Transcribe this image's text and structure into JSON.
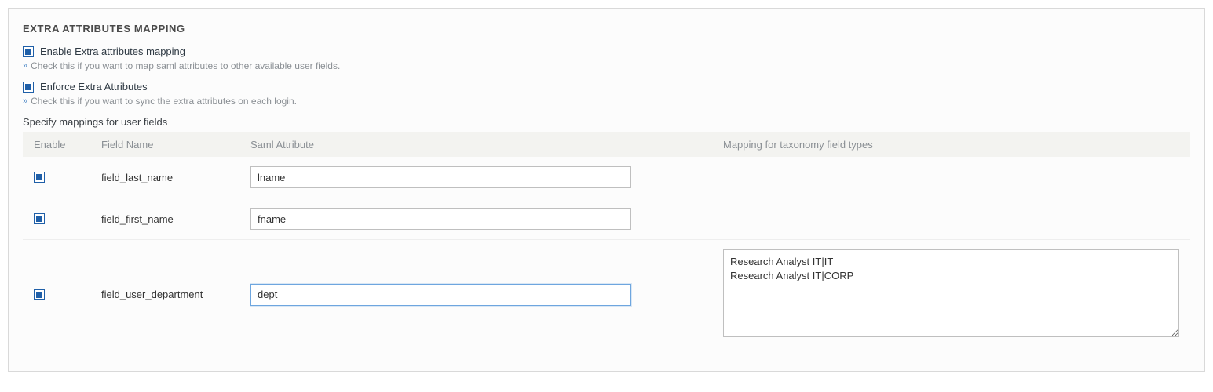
{
  "panel": {
    "title": "EXTRA ATTRIBUTES MAPPING"
  },
  "options": {
    "enable_mapping": {
      "label": "Enable Extra attributes mapping",
      "checked": true,
      "hint": "Check this if you want to map saml attributes to other available user fields."
    },
    "enforce_attrs": {
      "label": "Enforce Extra Attributes",
      "checked": true,
      "hint": "Check this if you want to sync the extra attributes on each login."
    }
  },
  "mapping": {
    "subhead": "Specify mappings for user fields",
    "headers": {
      "enable": "Enable",
      "field": "Field Name",
      "saml": "Saml Attribute",
      "taxonomy": "Mapping for taxonomy field types"
    },
    "rows": [
      {
        "enabled": true,
        "field": "field_last_name",
        "saml": "lname",
        "taxonomy": "",
        "focused": false,
        "has_taxonomy": false
      },
      {
        "enabled": true,
        "field": "field_first_name",
        "saml": "fname",
        "taxonomy": "",
        "focused": false,
        "has_taxonomy": false
      },
      {
        "enabled": true,
        "field": "field_user_department",
        "saml": "dept",
        "taxonomy": "Research Analyst IT|IT\nResearch Analyst IT|CORP",
        "focused": true,
        "has_taxonomy": true
      }
    ]
  }
}
